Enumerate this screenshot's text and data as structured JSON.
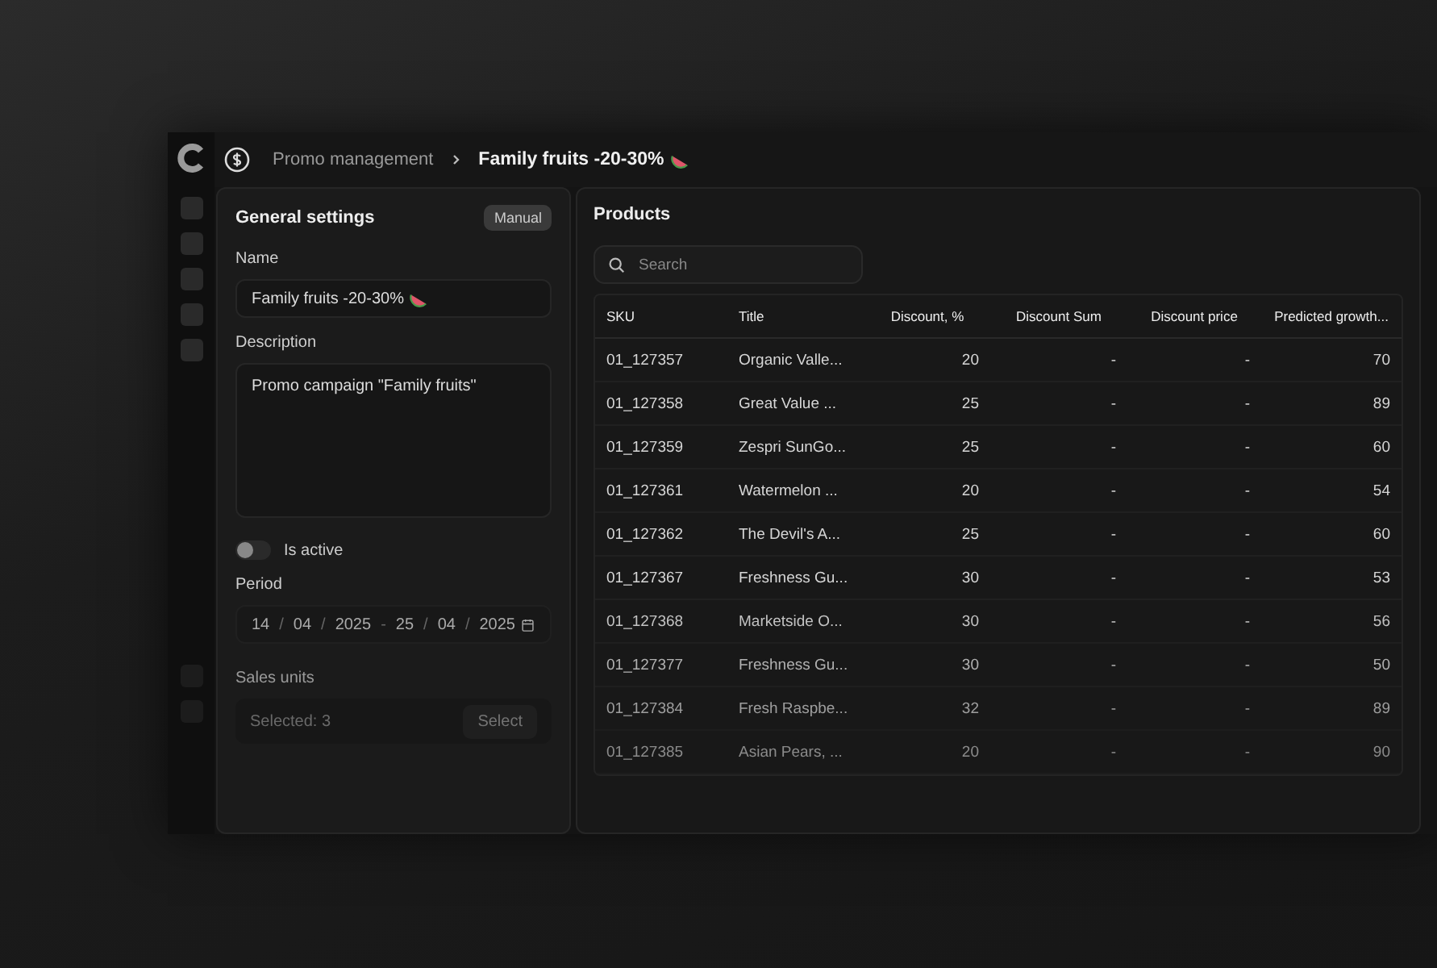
{
  "breadcrumb": {
    "parent": "Promo management",
    "current": "Family fruits -20-30%"
  },
  "general_settings": {
    "title": "General settings",
    "badge": "Manual",
    "name": {
      "label": "Name",
      "value": "Family fruits -20-30%"
    },
    "description": {
      "label": "Description",
      "value": "Promo campaign \"Family fruits\""
    },
    "is_active": {
      "label": "Is active",
      "on": false
    },
    "period": {
      "label": "Period",
      "start": [
        "14",
        "04",
        "2025"
      ],
      "end": [
        "25",
        "04",
        "2025"
      ],
      "separator": "/",
      "dash": "-"
    },
    "sales_units": {
      "label": "Sales units",
      "placeholder": "Selected: 3",
      "button": "Select"
    }
  },
  "products": {
    "title": "Products",
    "search": {
      "placeholder": "Search"
    },
    "table": {
      "columns": [
        "SKU",
        "Title",
        "Discount, %",
        "Discount Sum",
        "Discount price",
        "Predicted growth..."
      ],
      "rows": [
        [
          "01_127357",
          "Organic Valle...",
          "20",
          "-",
          "-",
          "70"
        ],
        [
          "01_127358",
          "Great Value ...",
          "25",
          "-",
          "-",
          "89"
        ],
        [
          "01_127359",
          "Zespri SunGo...",
          "25",
          "-",
          "-",
          "60"
        ],
        [
          "01_127361",
          "Watermelon ...",
          "20",
          "-",
          "-",
          "54"
        ],
        [
          "01_127362",
          "The Devil's A...",
          "25",
          "-",
          "-",
          "60"
        ],
        [
          "01_127367",
          "Freshness Gu...",
          "30",
          "-",
          "-",
          "53"
        ],
        [
          "01_127368",
          "Marketside O...",
          "30",
          "-",
          "-",
          "56"
        ],
        [
          "01_127377",
          "Freshness Gu...",
          "30",
          "-",
          "-",
          "50"
        ],
        [
          "01_127384",
          "Fresh Raspbe...",
          "32",
          "-",
          "-",
          "89"
        ],
        [
          "01_127385",
          "Asian Pears, ...",
          "20",
          "-",
          "-",
          "90"
        ]
      ]
    }
  }
}
